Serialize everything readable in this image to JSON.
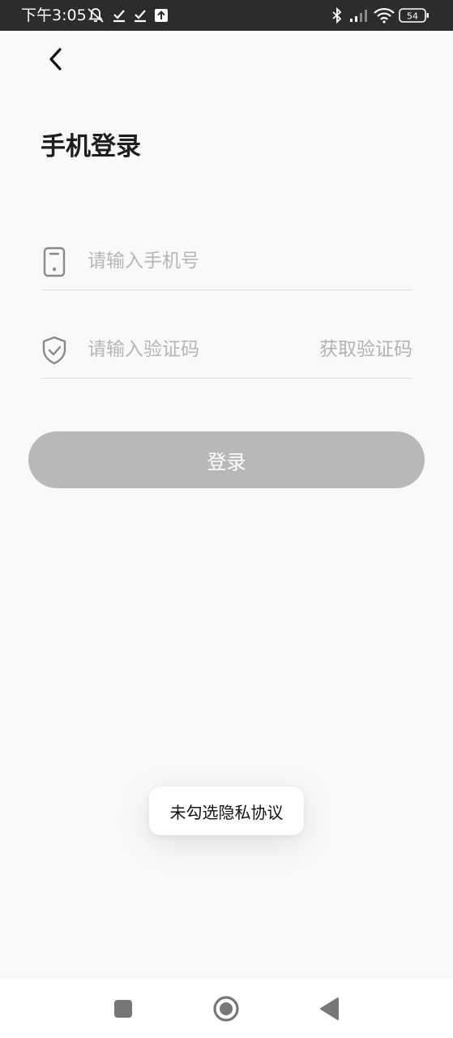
{
  "status_bar": {
    "time": "下午3:05",
    "battery_level": "54",
    "icons": [
      "mute-bell-icon",
      "check-icon",
      "check-icon",
      "upload-icon",
      "bluetooth-icon",
      "signal-icon",
      "wifi-icon",
      "battery-icon"
    ]
  },
  "header": {
    "back_icon": "chevron-left-icon",
    "title": "手机登录"
  },
  "form": {
    "phone": {
      "icon": "phone-icon",
      "value": "",
      "placeholder": "请输入手机号"
    },
    "code": {
      "icon": "shield-check-icon",
      "value": "",
      "placeholder": "请输入验证码",
      "get_code_label": "获取验证码"
    },
    "login_label": "登录"
  },
  "toast": {
    "message": "未勾选隐私协议"
  },
  "nav_bar": {
    "buttons": [
      "recent-apps-icon",
      "home-icon",
      "back-triangle-icon"
    ]
  },
  "colors": {
    "status_bar_bg": "#2c2c2c",
    "page_bg": "#f9f9f9",
    "button_disabled": "#b8b8b8",
    "placeholder": "#b6b6b6"
  }
}
